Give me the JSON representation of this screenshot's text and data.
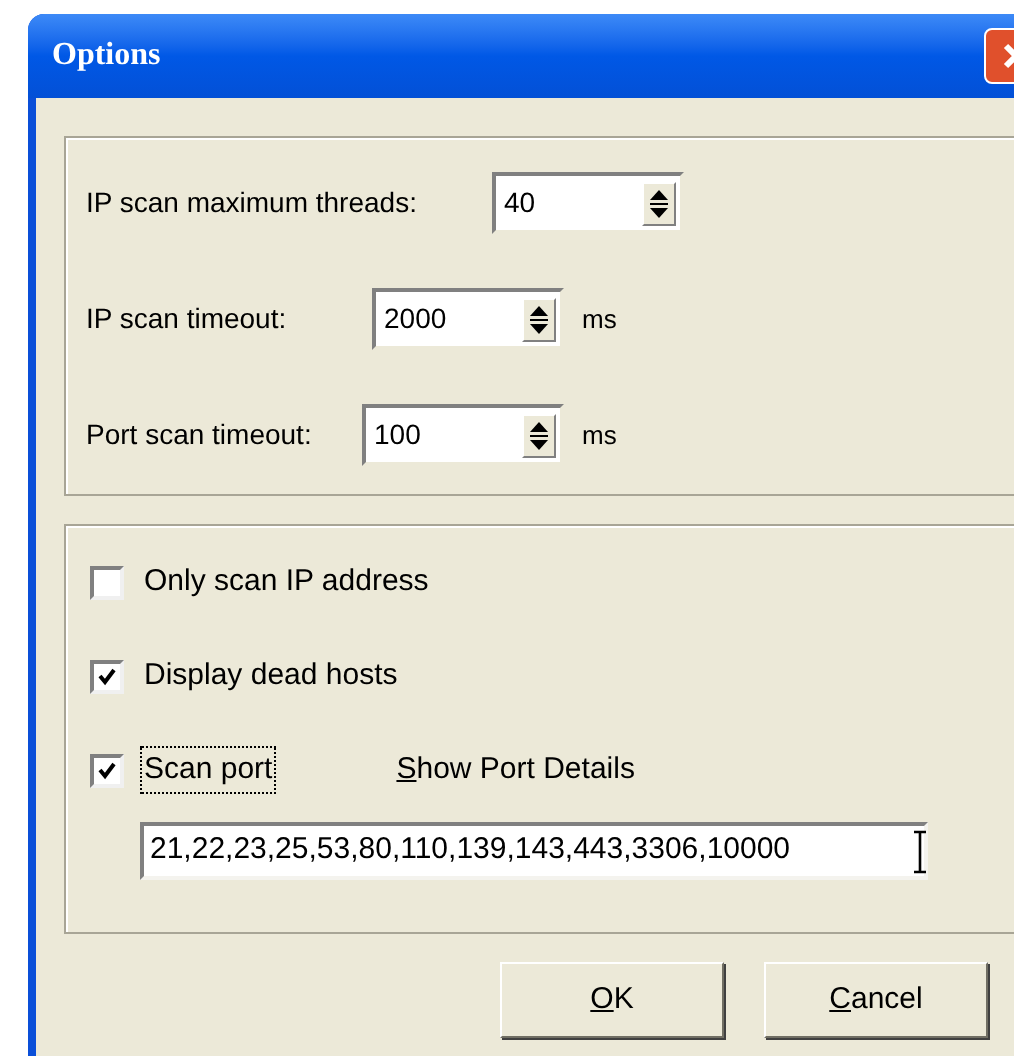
{
  "window": {
    "title": "Options"
  },
  "scan_settings": [
    {
      "label": "IP scan maximum threads:",
      "value": "40"
    },
    {
      "label": "IP scan timeout:",
      "value": "2000",
      "unit": "ms"
    },
    {
      "label": "Port scan timeout:",
      "value": "100",
      "unit": "ms"
    }
  ],
  "options": [
    {
      "label": "Only scan IP address",
      "checked": false,
      "focused": false
    },
    {
      "label": "Display dead hosts",
      "checked": true,
      "focused": false
    },
    {
      "label": "Scan port",
      "checked": true,
      "focused": true
    }
  ],
  "show_port_details": {
    "label": "Show Port Details",
    "mnemonic": true
  },
  "ports_field": {
    "value": "21,22,23,25,53,80,110,139,143,443,3306,10000"
  },
  "buttons": [
    {
      "label": "OK",
      "mnemonic": true
    },
    {
      "label": "Cancel",
      "mnemonic": true
    }
  ]
}
